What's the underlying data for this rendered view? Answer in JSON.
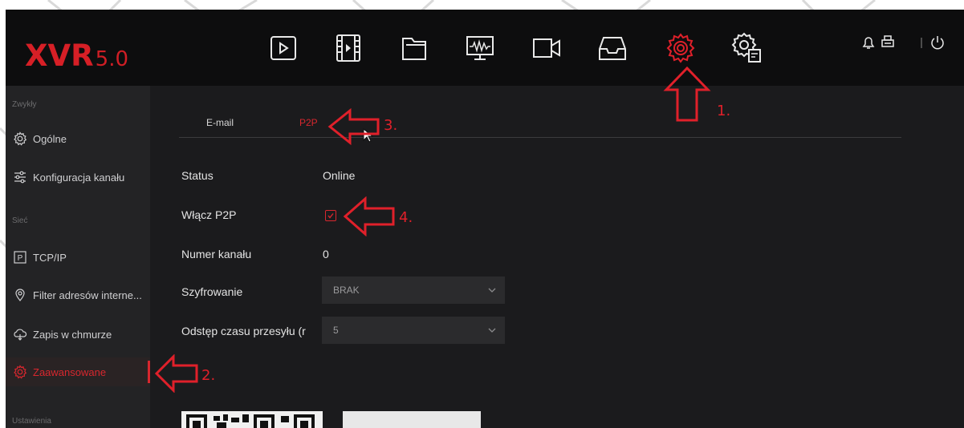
{
  "app": {
    "brand": "XVR",
    "version": "5.0"
  },
  "colors": {
    "accent": "#d8272e",
    "background": "#1b1b1d",
    "topbar": "#0d0d0e",
    "sidebar": "#232325"
  },
  "nav_icons": [
    "playback-icon",
    "video-clip-icon",
    "folder-icon",
    "monitor-waveform-icon",
    "camera-icon",
    "inbox-icon",
    "settings-gear-icon",
    "system-settings-icon"
  ],
  "top_right_icons": [
    "bell-icon",
    "printer-icon",
    "power-icon"
  ],
  "sidebar": {
    "sections": [
      {
        "title": "Zwykły",
        "items": [
          {
            "label": "Ogólne",
            "icon": "gear-icon"
          },
          {
            "label": "Konfiguracja kanału",
            "icon": "sliders-icon"
          }
        ]
      },
      {
        "title": "Sieć",
        "items": [
          {
            "label": "TCP/IP",
            "icon": "p-box-icon"
          },
          {
            "label": "Filter adresów interne...",
            "icon": "map-pin-icon"
          },
          {
            "label": "Zapis w chmurze",
            "icon": "cloud-icon"
          },
          {
            "label": "Zaawansowane",
            "icon": "advanced-gear-icon",
            "active": true
          }
        ]
      },
      {
        "title": "Ustawienia",
        "items": []
      }
    ]
  },
  "tabs": [
    {
      "label": "E-mail",
      "active": false
    },
    {
      "label": "P2P",
      "active": true
    }
  ],
  "form": {
    "status_label": "Status",
    "status_value": "Online",
    "enable_label": "Włącz P2P",
    "enable_checked": true,
    "channel_label": "Numer kanału",
    "channel_value": "0",
    "encryption_label": "Szyfrowanie",
    "encryption_value": "BRAK",
    "interval_label": "Odstęp czasu przesyłu (r",
    "interval_value": "5"
  },
  "annotations": [
    "1.",
    "2.",
    "3.",
    "4."
  ]
}
